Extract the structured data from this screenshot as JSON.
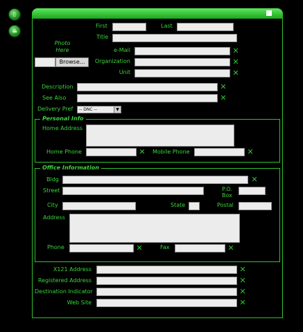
{
  "form": {
    "first_label": "First",
    "last_label": "Last",
    "title_label": "Title",
    "photo_label": "Photo\nHere",
    "browse_label": "Browse...",
    "email_label": "e-Mail",
    "organization_label": "Organization",
    "unit_label": "Unit",
    "description_label": "Description",
    "see_also_label": "See Also",
    "delivery_pref_label": "Delivery Pref",
    "delivery_pref_value": "-- DNC --"
  },
  "personal": {
    "legend": "Personal Info",
    "home_address_label": "Home Address",
    "home_phone_label": "Home Phone",
    "mobile_phone_label": "Mobile Phone"
  },
  "office": {
    "legend": "Office Information",
    "bldg_label": "Bldg",
    "street_label": "Street",
    "po_box_label": "P.O.\nBox",
    "city_label": "City",
    "state_label": "State",
    "postal_label": "Postal",
    "address_label": "Address",
    "phone_label": "Phone",
    "fax_label": "Fax"
  },
  "bottom": {
    "x121_label": "X121 Address",
    "registered_label": "Registered Address",
    "destination_label": "Destination Indicator",
    "website_label": "Web Site"
  },
  "icons": {
    "delete": "✕",
    "trash": "▯",
    "eject": "⏏"
  },
  "colors": {
    "accent": "#3cd43c",
    "background": "#000000"
  }
}
